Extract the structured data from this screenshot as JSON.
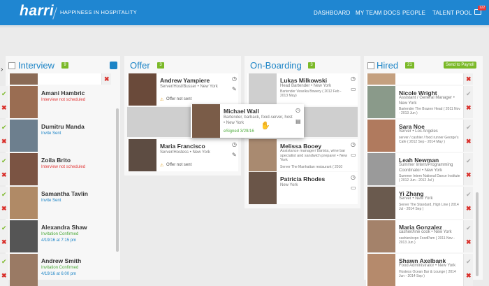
{
  "header": {
    "logo": "harri",
    "tagline": "HAPPINESS IN HOSPITALITY",
    "nav": [
      "DASHBOARD",
      "MY TEAM DOCS",
      "PEOPLE",
      "TALENT POOL"
    ],
    "mail_badge": "122"
  },
  "columns": {
    "interview": {
      "title": "Interview",
      "count": "9",
      "cards": [
        {
          "name": "Amani Hambric",
          "status": "Interview not scheduled"
        },
        {
          "name": "Dumitru Manda",
          "status": "Invite Sent"
        },
        {
          "name": "Zoila Brito",
          "status": "Interview not scheduled"
        },
        {
          "name": "Samantha Tavlin",
          "status": "Invite Sent"
        },
        {
          "name": "Alexandra Shaw",
          "status": "Invitation Confirmed",
          "date": "4/19/16 at 7:15 pm"
        },
        {
          "name": "Andrew Smith",
          "status": "Invitation Confirmed",
          "date": "4/19/16 at 6:00 pm"
        }
      ]
    },
    "offer": {
      "title": "Offer",
      "count": "3",
      "cards": [
        {
          "name": "Andrew Yampiere",
          "sub": "Server/Host/Busser • New York",
          "status": "Offer not sent"
        },
        {
          "name": "Maria Francisco",
          "sub": "Server/Hostess • New York",
          "status": "Offer not sent"
        }
      ]
    },
    "dragged": {
      "name": "Michael Wall",
      "sub": "Bartender, barback, food-server, host • New York",
      "status": "eSigned 3/29/16"
    },
    "onboarding": {
      "title": "On-Boarding",
      "count": "3",
      "cards": [
        {
          "name": "Lukas Milkowski",
          "sub": "Head Bartender • New York",
          "extra": "Bartender Veselka Bowery ( 2012 Feb - 2013 May)"
        },
        {
          "name": "Melissa Booey",
          "sub": "Assistance manager/ barista, wine bar specialist and sandwich preparer • New York",
          "extra": "Server The Manhattan restaurant ( 2010"
        },
        {
          "name": "Patricia Rhodes",
          "sub": "New York",
          "extra": ""
        }
      ]
    },
    "hired": {
      "title": "Hired",
      "count": "21",
      "button": "Send to Payroll",
      "cards": [
        {
          "name": "Nicole Wright",
          "sub": "Assistant / General Manager • New York",
          "extra": "Bartender The Brazen Head ( 2011 Nov - 2013 Jun )"
        },
        {
          "name": "Sara Noe",
          "sub": "Server • Los Angeles",
          "extra": "server / cashier / food runner George's Cafe ( 2012 Sep - 2014 May )"
        },
        {
          "name": "Leah Newman",
          "sub": "Summer Intern/Programming Coordinator • New York",
          "extra": "Summer Intern National Dance Institute ( 2012 Jun - 2012 Jul )"
        },
        {
          "name": "Yi Zhang",
          "sub": "Server • New York",
          "extra": "Server The Standard, High Line ( 2014 Jul - 2014 Sep )"
        },
        {
          "name": "Maria Gonzalez",
          "sub": "cashier/line cook • New York",
          "extra": "cashier/expo FoodPam ( 2011 Nov - 2013 Jun )"
        },
        {
          "name": "Shawn Axelbank",
          "sub": "Food Administrator • New York",
          "extra": "Hostess Ocean Bar & Lounge ( 2014 Jun - 2014 Sep )"
        }
      ]
    }
  },
  "colors": {
    "brand": "#1f86d1",
    "count_green": "#7bb928",
    "alert_red": "#e23a3a"
  }
}
